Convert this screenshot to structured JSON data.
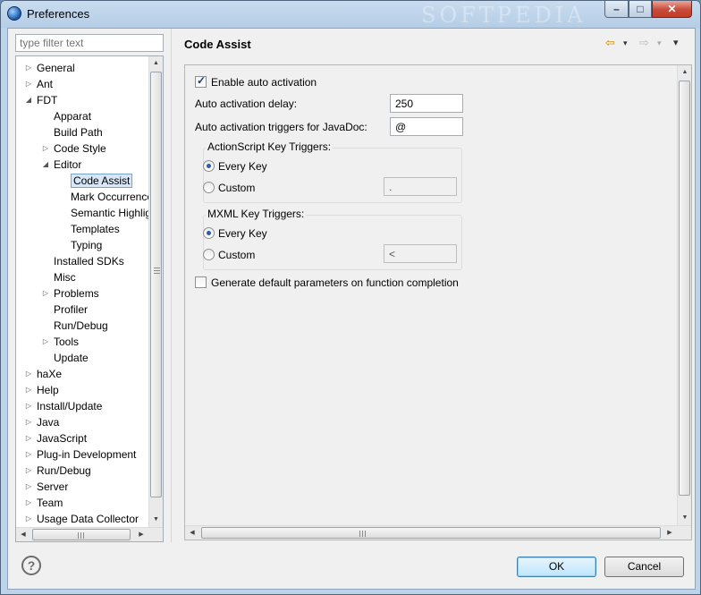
{
  "window": {
    "title": "Preferences",
    "watermark": "SOFTPEDIA"
  },
  "window_controls": {
    "minimize": "–",
    "maximize": "□",
    "close": "✕"
  },
  "filter": {
    "placeholder": "type filter text"
  },
  "tree": {
    "items": [
      {
        "label": "General",
        "level": 0,
        "state": "collapsed"
      },
      {
        "label": "Ant",
        "level": 0,
        "state": "collapsed"
      },
      {
        "label": "FDT",
        "level": 0,
        "state": "expanded"
      },
      {
        "label": "Apparat",
        "level": 1,
        "state": "leaf"
      },
      {
        "label": "Build Path",
        "level": 1,
        "state": "leaf"
      },
      {
        "label": "Code Style",
        "level": 1,
        "state": "collapsed"
      },
      {
        "label": "Editor",
        "level": 1,
        "state": "expanded"
      },
      {
        "label": "Code Assist",
        "level": 2,
        "state": "leaf",
        "selected": true
      },
      {
        "label": "Mark Occurrences",
        "level": 2,
        "state": "leaf"
      },
      {
        "label": "Semantic Highlighting",
        "level": 2,
        "state": "leaf"
      },
      {
        "label": "Templates",
        "level": 2,
        "state": "leaf"
      },
      {
        "label": "Typing",
        "level": 2,
        "state": "leaf"
      },
      {
        "label": "Installed SDKs",
        "level": 1,
        "state": "leaf"
      },
      {
        "label": "Misc",
        "level": 1,
        "state": "leaf"
      },
      {
        "label": "Problems",
        "level": 1,
        "state": "collapsed"
      },
      {
        "label": "Profiler",
        "level": 1,
        "state": "leaf"
      },
      {
        "label": "Run/Debug",
        "level": 1,
        "state": "leaf"
      },
      {
        "label": "Tools",
        "level": 1,
        "state": "collapsed"
      },
      {
        "label": "Update",
        "level": 1,
        "state": "leaf"
      },
      {
        "label": "haXe",
        "level": 0,
        "state": "collapsed"
      },
      {
        "label": "Help",
        "level": 0,
        "state": "collapsed"
      },
      {
        "label": "Install/Update",
        "level": 0,
        "state": "collapsed"
      },
      {
        "label": "Java",
        "level": 0,
        "state": "collapsed"
      },
      {
        "label": "JavaScript",
        "level": 0,
        "state": "collapsed"
      },
      {
        "label": "Plug-in Development",
        "level": 0,
        "state": "collapsed"
      },
      {
        "label": "Run/Debug",
        "level": 0,
        "state": "collapsed"
      },
      {
        "label": "Server",
        "level": 0,
        "state": "collapsed"
      },
      {
        "label": "Team",
        "level": 0,
        "state": "collapsed"
      },
      {
        "label": "Usage Data Collector",
        "level": 0,
        "state": "collapsed"
      }
    ]
  },
  "page": {
    "title": "Code Assist",
    "nav": {
      "back": "⇦",
      "forward": "⇨",
      "menu": "▾"
    },
    "enable_auto_activation": {
      "label": "Enable auto activation",
      "checked": true
    },
    "delay": {
      "label": "Auto activation delay:",
      "value": "250"
    },
    "javadoc_triggers": {
      "label": "Auto activation triggers for JavaDoc:",
      "value": "@"
    },
    "actionscript_group": {
      "title": "ActionScript Key Triggers:",
      "every_key": "Every Key",
      "custom": "Custom",
      "custom_value": ".",
      "selected": "every_key"
    },
    "mxml_group": {
      "title": "MXML Key Triggers:",
      "every_key": "Every Key",
      "custom": "Custom",
      "custom_value": "<",
      "selected": "every_key"
    },
    "generate_params": {
      "label": "Generate default parameters on function completion",
      "checked": false
    }
  },
  "buttons": {
    "help": "?",
    "ok": "OK",
    "cancel": "Cancel"
  },
  "colors": {
    "accent": "#3c7fb1",
    "selection": "#d7e7f8"
  }
}
